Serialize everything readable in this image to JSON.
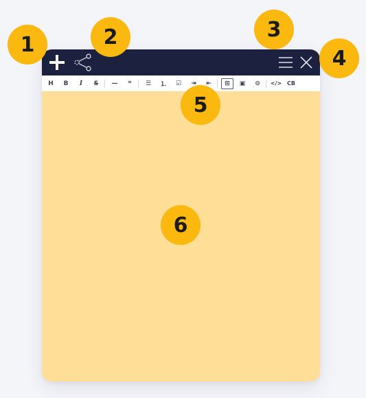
{
  "titlebar": {
    "add_icon": "plus-icon",
    "share_icon": "share-icon",
    "menu_icon": "hamburger-menu-icon",
    "close_icon": "close-icon"
  },
  "toolbar": {
    "items": [
      {
        "name": "heading",
        "label": "H"
      },
      {
        "name": "bold",
        "label": "B"
      },
      {
        "name": "italic",
        "label": "I"
      },
      {
        "name": "strikethrough",
        "label": "S"
      },
      {
        "name": "horizontal-rule",
        "label": "—"
      },
      {
        "name": "quote",
        "label": "❝"
      },
      {
        "name": "bullet-list",
        "label": "☰"
      },
      {
        "name": "numbered-list",
        "label": "⒈"
      },
      {
        "name": "task-list",
        "label": "☑"
      },
      {
        "name": "indent",
        "label": "⇥"
      },
      {
        "name": "outdent",
        "label": "⇤"
      },
      {
        "name": "table",
        "label": "⊞"
      },
      {
        "name": "image",
        "label": "▣"
      },
      {
        "name": "link",
        "label": "⊝"
      },
      {
        "name": "code",
        "label": "</>"
      },
      {
        "name": "code-block",
        "label": "CB"
      }
    ]
  },
  "callouts": [
    "1",
    "2",
    "3",
    "4",
    "5",
    "6"
  ],
  "colors": {
    "titlebar": "#1c2140",
    "note": "#ffdf97",
    "badge": "#fbb80f"
  }
}
